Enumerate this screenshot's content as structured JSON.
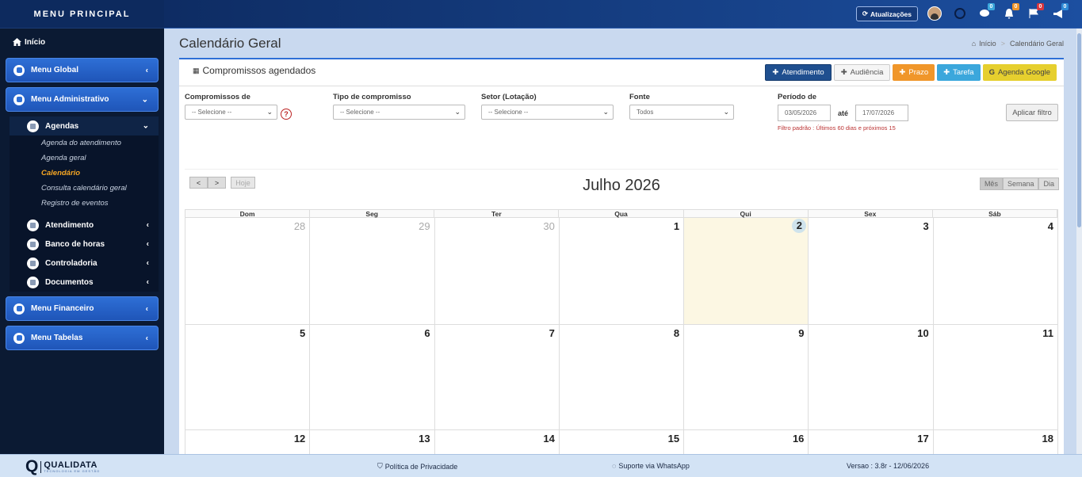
{
  "sidebar": {
    "title": "MENU PRINCIPAL",
    "home": "Início",
    "menus": {
      "global": "Menu Global",
      "admin": "Menu Administrativo",
      "financeiro": "Menu Financeiro",
      "tabelas": "Menu Tabelas"
    },
    "admin_items": {
      "agendas": "Agendas",
      "atendimento": "Atendimento",
      "banco_horas": "Banco de horas",
      "controladoria": "Controladoria",
      "documentos": "Documentos"
    },
    "agenda_links": [
      "Agenda do atendimento",
      "Agenda geral",
      "Calendário",
      "Consulta calendário geral",
      "Registro de eventos"
    ]
  },
  "topbar": {
    "updates": "Atualizações",
    "badges": {
      "messages": "0",
      "alerts": "0",
      "flags": "0",
      "notices": "0"
    }
  },
  "page": {
    "title": "Calendário Geral",
    "breadcrumb": {
      "home": "Início",
      "current": "Calendário Geral"
    }
  },
  "panel": {
    "title": "Compromissos agendados",
    "actions": {
      "atendimento": "Atendimento",
      "audiencia": "Audiência",
      "prazo": "Prazo",
      "tarefa": "Tarefa",
      "google": "Agenda Google"
    }
  },
  "filters": {
    "compromissos_label": "Compromissos de",
    "compromissos_value": "-- Selecione --",
    "tipo_label": "Tipo de compromisso",
    "tipo_value": "-- Selecione --",
    "setor_label": "Setor (Lotação)",
    "setor_value": "-- Selecione --",
    "fonte_label": "Fonte",
    "fonte_value": "Todos",
    "periodo_label": "Período de",
    "date_from": "03/05/2026",
    "ate": "até",
    "date_to": "17/07/2026",
    "note": "Filtro padrão : Últimos 60 dias e próximos 15",
    "apply": "Aplicar filtro"
  },
  "calendar": {
    "title": "Julho 2026",
    "today_label": "Hoje",
    "views": {
      "month": "Mês",
      "week": "Semana",
      "day": "Dia"
    },
    "weekdays": [
      "Dom",
      "Seg",
      "Ter",
      "Qua",
      "Qui",
      "Sex",
      "Sáb"
    ],
    "weeks": [
      [
        "28",
        "29",
        "30",
        "1",
        "2",
        "3",
        "4"
      ],
      [
        "5",
        "6",
        "7",
        "8",
        "9",
        "10",
        "11"
      ],
      [
        "12",
        "13",
        "14",
        "15",
        "16",
        "17",
        "18"
      ]
    ],
    "other_month_days": [
      "28",
      "29",
      "30"
    ],
    "today": "2"
  },
  "footer": {
    "logo": "QUALIDATA",
    "logo_sub": "TECNOLOGIA EM GESTÃO",
    "privacy": "Política de Privacidade",
    "support": "Suporte via WhatsApp",
    "version": "Versao : 3.8r - 12/06/2026"
  },
  "colors": {
    "sidebar_bg": "#0b1a33",
    "menu_blue": "#2e6fd6",
    "active_link": "#f5a623",
    "btn_atendimento": "#1f4f8f",
    "btn_prazo": "#f0962a",
    "btn_tarefa": "#3ba7dc",
    "btn_google": "#e6cf2e",
    "today_bg": "#fcf7e3"
  }
}
